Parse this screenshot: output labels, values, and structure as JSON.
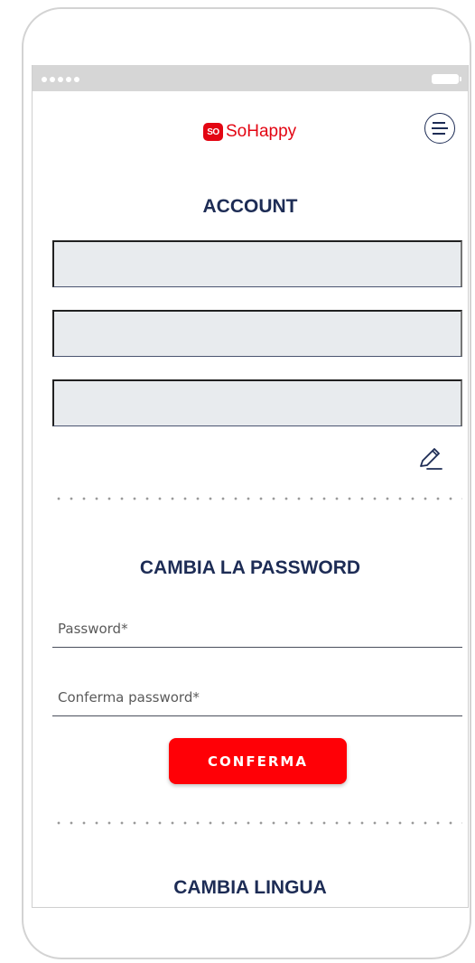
{
  "app": {
    "logo_mark": "SO",
    "logo_name": "SoHappy",
    "brand_color": "#e30613",
    "navy_color": "#1d2c55"
  },
  "status_bar": {
    "signal_icon": "signal-dots-icon",
    "battery_icon": "battery-icon"
  },
  "header": {
    "menu_icon": "hamburger-menu-icon"
  },
  "account": {
    "title": "ACCOUNT",
    "fields": [
      {
        "value": ""
      },
      {
        "value": ""
      },
      {
        "value": ""
      }
    ],
    "edit_icon": "pencil-edit-icon"
  },
  "password": {
    "title": "CAMBIA LA PASSWORD",
    "password_placeholder": "Password*",
    "confirm_placeholder": "Conferma password*",
    "confirm_label": "CONFERMA"
  },
  "language": {
    "title": "CAMBIA LINGUA"
  }
}
